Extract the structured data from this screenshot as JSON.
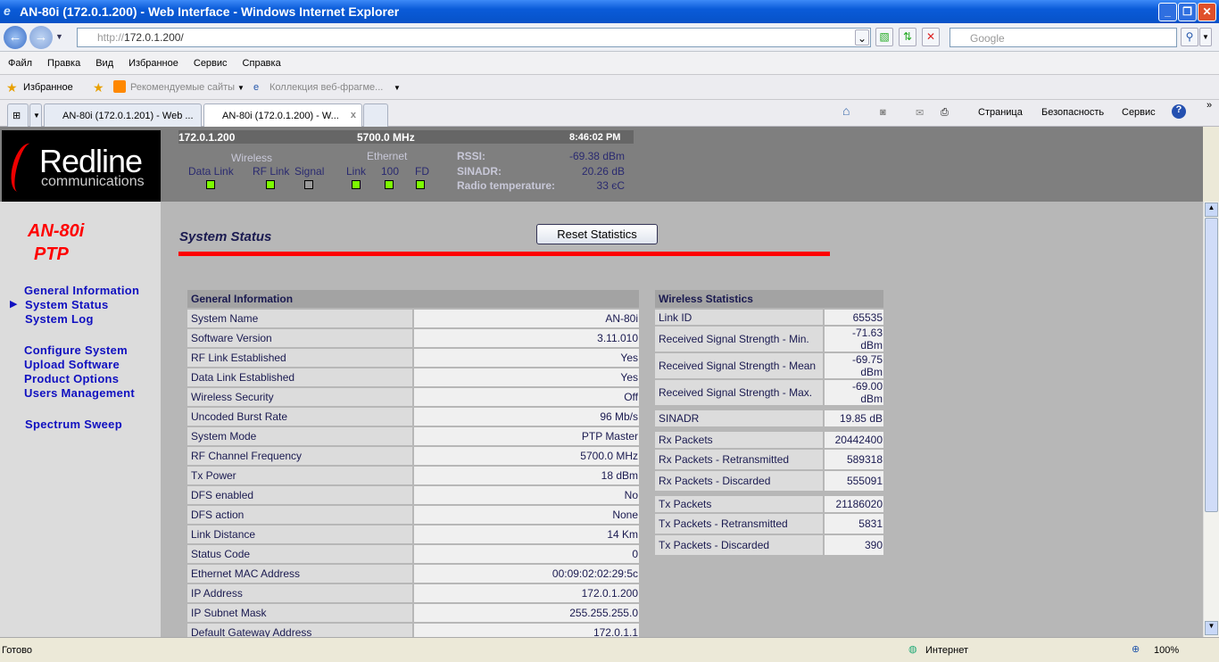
{
  "window": {
    "title": "AN-80i (172.0.1.200) - Web Interface - Windows Internet Explorer"
  },
  "address": {
    "scheme": "http://",
    "host": "172.0.1.200/",
    "search_placeholder": "Google"
  },
  "menu": [
    "Файл",
    "Правка",
    "Вид",
    "Избранное",
    "Сервис",
    "Справка"
  ],
  "favorites": {
    "label": "Избранное",
    "items": [
      "Рекомендуемые сайты",
      "Коллекция веб-фрагме..."
    ]
  },
  "tabs": [
    {
      "label": "AN-80i (172.0.1.201) - Web ..."
    },
    {
      "label": "AN-80i (172.0.1.200) - W...",
      "active": true
    }
  ],
  "commandbar": {
    "page": "Страница",
    "safety": "Безопасность",
    "tools": "Сервис"
  },
  "header": {
    "ip": "172.0.1.200",
    "freq": "5700.0 MHz",
    "time": "8:46:02 PM",
    "wireless_label": "Wireless",
    "ethernet_label": "Ethernet",
    "leds": [
      {
        "label": "Data Link",
        "on": true
      },
      {
        "label": "RF Link",
        "on": true
      },
      {
        "label": "Signal",
        "on": false
      },
      {
        "label": "Link",
        "on": true
      },
      {
        "label": "100",
        "on": true
      },
      {
        "label": "FD",
        "on": true
      }
    ],
    "rssi_label": "RSSI:",
    "rssi": "-69.38 dBm",
    "sinadr_label": "SINADR:",
    "sinadr": "20.26 dB",
    "temp_label": "Radio temperature:",
    "temp": "33 єC",
    "led_on_color": "#7cfc00",
    "led_off_color": "#9a9a9a"
  },
  "logo": {
    "name": "Redline",
    "sub": "communications"
  },
  "sidebar": {
    "product": "AN-80i",
    "mode": "PTP",
    "nav": [
      "General Information",
      "System Status",
      "System Log",
      "Configure System",
      "Upload Software",
      "Product Options",
      "Users Management",
      "Spectrum Sweep"
    ],
    "active": 1
  },
  "main": {
    "title": "System Status",
    "reset_button": "Reset Statistics",
    "general": {
      "header": "General Information",
      "rows": [
        [
          "System Name",
          "AN-80i"
        ],
        [
          "Software Version",
          "3.11.010"
        ],
        [
          "RF Link Established",
          "Yes"
        ],
        [
          "Data Link Established",
          "Yes"
        ],
        [
          "Wireless Security",
          "Off"
        ],
        [
          "Uncoded Burst Rate",
          "96 Mb/s"
        ],
        [
          "System Mode",
          "PTP Master"
        ],
        [
          "RF Channel Frequency",
          "5700.0 MHz"
        ],
        [
          "Tx Power",
          "18 dBm"
        ],
        [
          "DFS enabled",
          "No"
        ],
        [
          "DFS action",
          "None"
        ],
        [
          "Link Distance",
          "14 Km"
        ],
        [
          "Status Code",
          "0"
        ],
        [
          "Ethernet MAC Address",
          "00:09:02:02:29:5c"
        ],
        [
          "IP Address",
          "172.0.1.200"
        ],
        [
          "IP Subnet Mask",
          "255.255.255.0"
        ],
        [
          "Default Gateway Address",
          "172.0.1.1"
        ]
      ]
    },
    "wireless": {
      "header": "Wireless Statistics",
      "groups": [
        [
          [
            "Link ID",
            "65535"
          ],
          [
            "Received Signal Strength - Min.",
            "-71.63 dBm"
          ],
          [
            "Received Signal Strength - Mean",
            "-69.75 dBm"
          ],
          [
            "Received Signal Strength - Max.",
            "-69.00 dBm"
          ]
        ],
        [
          [
            "SINADR",
            "19.85 dB"
          ]
        ],
        [
          [
            "Rx Packets",
            "20442400"
          ],
          [
            "Rx Packets - Retransmitted",
            "589318"
          ],
          [
            "Rx Packets - Discarded",
            "555091"
          ]
        ],
        [
          [
            "Tx Packets",
            "21186020"
          ],
          [
            "Tx Packets - Retransmitted",
            "5831"
          ],
          [
            "Tx Packets - Discarded",
            "390"
          ]
        ]
      ]
    }
  },
  "statusbar": {
    "text": "Готово",
    "zone": "Интернет",
    "zoom": "100%"
  }
}
